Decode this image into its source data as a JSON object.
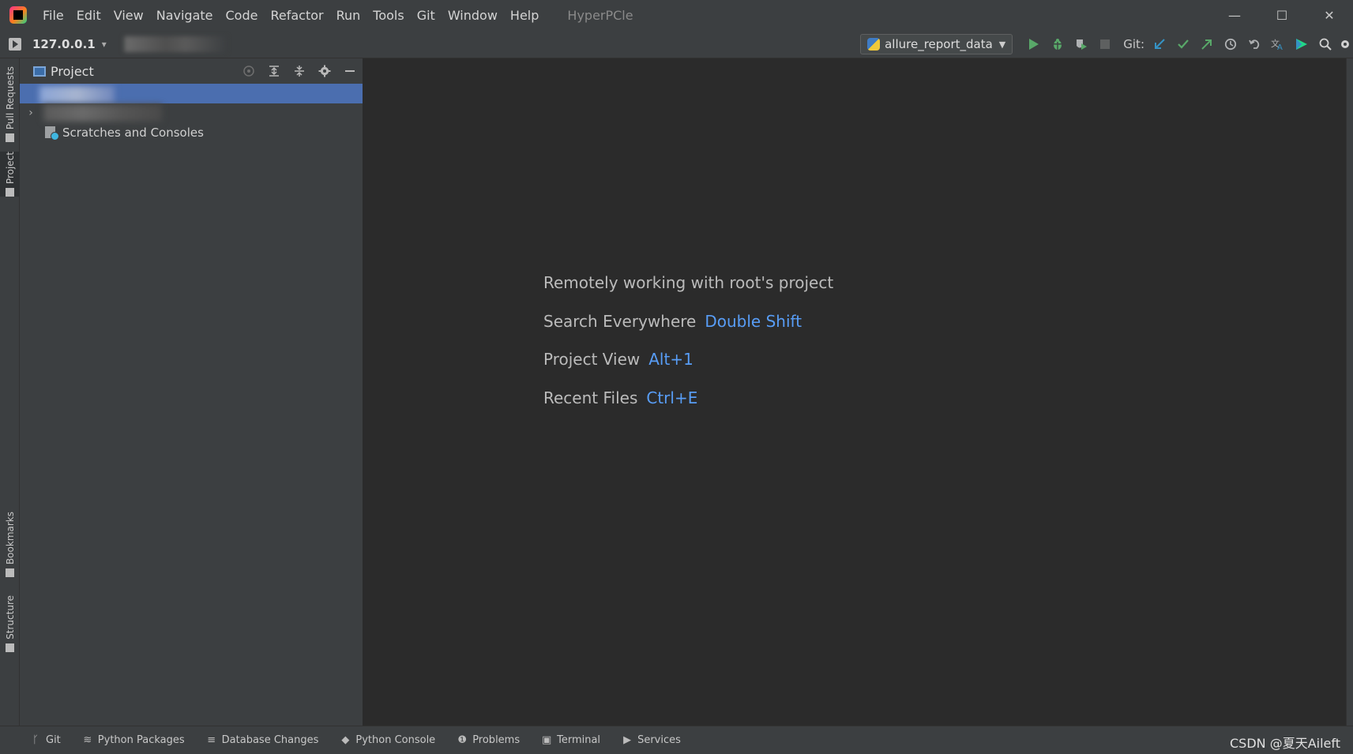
{
  "menu": [
    "File",
    "Edit",
    "View",
    "Navigate",
    "Code",
    "Refactor",
    "Run",
    "Tools",
    "Git",
    "Window",
    "Help"
  ],
  "window_title": "HyperPCle",
  "window_controls": {
    "minimize": "—",
    "maximize": "☐",
    "close": "✕"
  },
  "toolbar": {
    "host": "127.0.0.1",
    "run_config": "allure_report_data",
    "git_label": "Git:"
  },
  "left_stripe": {
    "pull_requests": "Pull Requests",
    "project": "Project",
    "bookmarks": "Bookmarks",
    "structure": "Structure"
  },
  "project_panel": {
    "title": "Project",
    "tree": [
      {
        "label": "",
        "blurred": true,
        "selected": true
      },
      {
        "label": "",
        "blurred": true,
        "expandable": true
      },
      {
        "label": "Scratches and Consoles"
      }
    ]
  },
  "editor": {
    "hints": [
      {
        "text": "Remotely working with root's project",
        "shortcut": ""
      },
      {
        "text": "Search Everywhere",
        "shortcut": "Double Shift"
      },
      {
        "text": "Project View",
        "shortcut": "Alt+1"
      },
      {
        "text": "Recent Files",
        "shortcut": "Ctrl+E"
      }
    ]
  },
  "bottom_tabs": [
    "Git",
    "Python Packages",
    "Database Changes",
    "Python Console",
    "Problems",
    "Terminal",
    "Services"
  ],
  "watermark": "CSDN @夏天Aileft",
  "colors": {
    "shortcut": "#589df6",
    "selection": "#4b6eaf",
    "panel_bg": "#3c3f41",
    "editor_bg": "#2b2b2b",
    "run_green": "#59a869",
    "git_update_blue": "#3592c4"
  }
}
